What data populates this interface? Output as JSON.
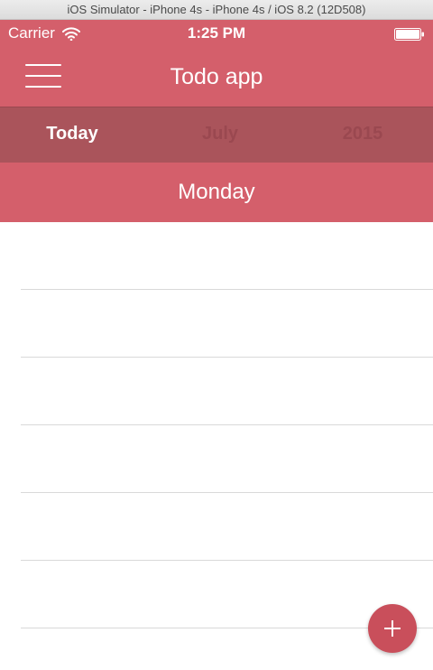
{
  "simulator": {
    "title": "iOS Simulator - iPhone 4s - iPhone 4s / iOS 8.2 (12D508)"
  },
  "status_bar": {
    "carrier": "Carrier",
    "time": "1:25 PM",
    "icons": [
      "wifi-icon",
      "battery-icon"
    ]
  },
  "nav_bar": {
    "title": "Todo app",
    "menu_icon": "hamburger-menu-icon"
  },
  "date_picker": {
    "today": "Today",
    "month": "July",
    "year": "2015"
  },
  "day_header": {
    "label": "Monday"
  },
  "todo_list": {
    "rows": [
      "",
      "",
      "",
      "",
      "",
      ""
    ]
  },
  "fab": {
    "icon": "plus-icon"
  },
  "colors": {
    "accent": "#d45f6b",
    "date_bar": "#aa545b",
    "date_inactive_text": "#9a4850",
    "fab": "#c94f5b"
  }
}
